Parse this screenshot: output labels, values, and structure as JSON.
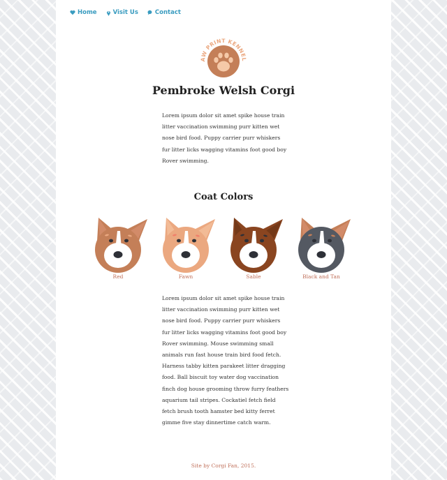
{
  "nav": {
    "items": [
      {
        "label": "Home",
        "icon": "heart-icon"
      },
      {
        "label": "Visit Us",
        "icon": "map-pin-icon"
      },
      {
        "label": "Contact",
        "icon": "speech-bubble-icon"
      }
    ]
  },
  "logo": {
    "text": "PAW PRINT KENNELS"
  },
  "title": "Pembroke Welsh Corgi",
  "intro": "Lorem ipsum dolor sit amet spike house train litter vaccination swimming purr kitten wet nose bird food. Puppy carrier purr whiskers fur litter licks wagging vitamins foot good boy Rover swimming.",
  "coat_heading": "Coat Colors",
  "coats": [
    {
      "label": "Red",
      "color": "#c47f58"
    },
    {
      "label": "Fawn",
      "color": "#eba880"
    },
    {
      "label": "Sable",
      "color": "#8a4520"
    },
    {
      "label": "Black and Tan",
      "color": "#545962"
    }
  ],
  "body": "Lorem ipsum dolor sit amet spike house train litter vaccination swimming purr kitten wet nose bird food. Puppy carrier purr whiskers fur litter licks wagging vitamins foot good boy Rover swimming. Mouse swimming small animals run fast house train bird food fetch. Harness tabby kitten parakeet litter dragging food. Ball biscuit toy water dog vaccination finch dog house grooming throw furry feathers aquarium tail stripes. Cockatiel fetch field fetch brush tooth hamster bed kitty ferret gimme five stay dinnertime catch warm.",
  "footer": "Site by Corgi Fan, 2015.",
  "colors": {
    "accent": "#3a9cc0",
    "brand": "#c0705a"
  }
}
